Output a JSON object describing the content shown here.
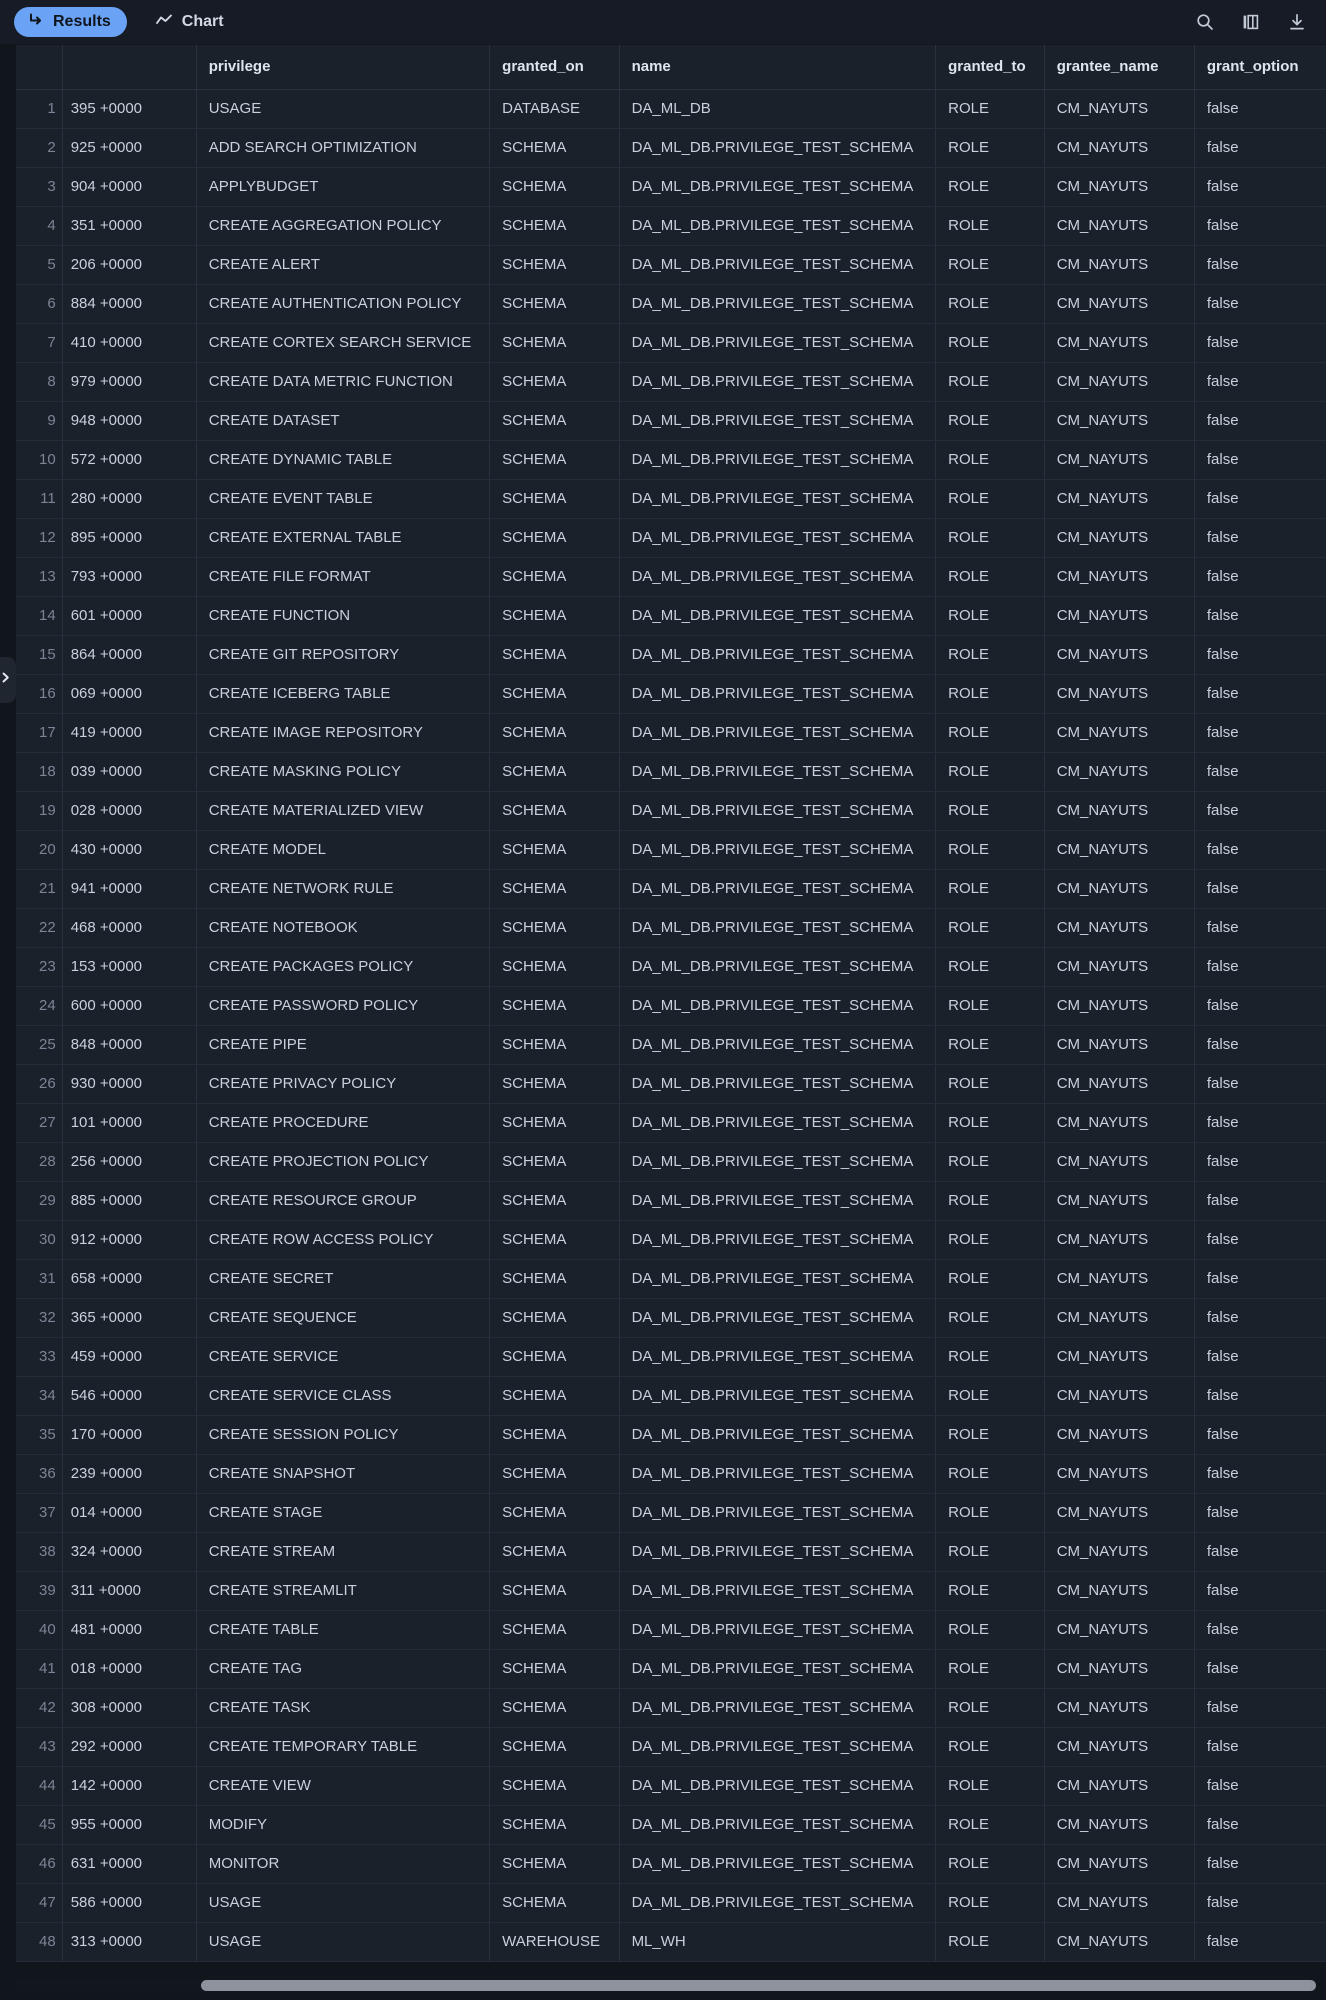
{
  "toolbar": {
    "results_tab": "Results",
    "chart_tab": "Chart",
    "results_icon": "return-arrow-icon",
    "chart_icon": "line-chart-icon",
    "search_icon": "search-icon",
    "columns_icon": "columns-icon",
    "download_icon": "download-icon",
    "accent_color": "#6aa3f5",
    "background_color": "#161b25"
  },
  "expand_handle": {
    "icon": "chevron-right-icon"
  },
  "table": {
    "columns": [
      {
        "key": "rownum",
        "label": ""
      },
      {
        "key": "timestamp",
        "label": ""
      },
      {
        "key": "privilege",
        "label": "privilege"
      },
      {
        "key": "granted_on",
        "label": "granted_on"
      },
      {
        "key": "name",
        "label": "name"
      },
      {
        "key": "granted_to",
        "label": "granted_to"
      },
      {
        "key": "grantee_name",
        "label": "grantee_name"
      },
      {
        "key": "grant_option",
        "label": "grant_option"
      }
    ],
    "rows": [
      {
        "n": "1",
        "ts": "395 +0000",
        "privilege": "USAGE",
        "granted_on": "DATABASE",
        "name": "DA_ML_DB",
        "granted_to": "ROLE",
        "grantee_name": "CM_NAYUTS",
        "grant_option": "false"
      },
      {
        "n": "2",
        "ts": "925 +0000",
        "privilege": "ADD SEARCH OPTIMIZATION",
        "granted_on": "SCHEMA",
        "name": "DA_ML_DB.PRIVILEGE_TEST_SCHEMA",
        "granted_to": "ROLE",
        "grantee_name": "CM_NAYUTS",
        "grant_option": "false"
      },
      {
        "n": "3",
        "ts": "904 +0000",
        "privilege": "APPLYBUDGET",
        "granted_on": "SCHEMA",
        "name": "DA_ML_DB.PRIVILEGE_TEST_SCHEMA",
        "granted_to": "ROLE",
        "grantee_name": "CM_NAYUTS",
        "grant_option": "false"
      },
      {
        "n": "4",
        "ts": "351 +0000",
        "privilege": "CREATE AGGREGATION POLICY",
        "granted_on": "SCHEMA",
        "name": "DA_ML_DB.PRIVILEGE_TEST_SCHEMA",
        "granted_to": "ROLE",
        "grantee_name": "CM_NAYUTS",
        "grant_option": "false"
      },
      {
        "n": "5",
        "ts": "206 +0000",
        "privilege": "CREATE ALERT",
        "granted_on": "SCHEMA",
        "name": "DA_ML_DB.PRIVILEGE_TEST_SCHEMA",
        "granted_to": "ROLE",
        "grantee_name": "CM_NAYUTS",
        "grant_option": "false"
      },
      {
        "n": "6",
        "ts": "884 +0000",
        "privilege": "CREATE AUTHENTICATION POLICY",
        "granted_on": "SCHEMA",
        "name": "DA_ML_DB.PRIVILEGE_TEST_SCHEMA",
        "granted_to": "ROLE",
        "grantee_name": "CM_NAYUTS",
        "grant_option": "false"
      },
      {
        "n": "7",
        "ts": "410 +0000",
        "privilege": "CREATE CORTEX SEARCH SERVICE",
        "granted_on": "SCHEMA",
        "name": "DA_ML_DB.PRIVILEGE_TEST_SCHEMA",
        "granted_to": "ROLE",
        "grantee_name": "CM_NAYUTS",
        "grant_option": "false"
      },
      {
        "n": "8",
        "ts": "979 +0000",
        "privilege": "CREATE DATA METRIC FUNCTION",
        "granted_on": "SCHEMA",
        "name": "DA_ML_DB.PRIVILEGE_TEST_SCHEMA",
        "granted_to": "ROLE",
        "grantee_name": "CM_NAYUTS",
        "grant_option": "false"
      },
      {
        "n": "9",
        "ts": "948 +0000",
        "privilege": "CREATE DATASET",
        "granted_on": "SCHEMA",
        "name": "DA_ML_DB.PRIVILEGE_TEST_SCHEMA",
        "granted_to": "ROLE",
        "grantee_name": "CM_NAYUTS",
        "grant_option": "false"
      },
      {
        "n": "10",
        "ts": "572 +0000",
        "privilege": "CREATE DYNAMIC TABLE",
        "granted_on": "SCHEMA",
        "name": "DA_ML_DB.PRIVILEGE_TEST_SCHEMA",
        "granted_to": "ROLE",
        "grantee_name": "CM_NAYUTS",
        "grant_option": "false"
      },
      {
        "n": "11",
        "ts": "280 +0000",
        "privilege": "CREATE EVENT TABLE",
        "granted_on": "SCHEMA",
        "name": "DA_ML_DB.PRIVILEGE_TEST_SCHEMA",
        "granted_to": "ROLE",
        "grantee_name": "CM_NAYUTS",
        "grant_option": "false"
      },
      {
        "n": "12",
        "ts": "895 +0000",
        "privilege": "CREATE EXTERNAL TABLE",
        "granted_on": "SCHEMA",
        "name": "DA_ML_DB.PRIVILEGE_TEST_SCHEMA",
        "granted_to": "ROLE",
        "grantee_name": "CM_NAYUTS",
        "grant_option": "false"
      },
      {
        "n": "13",
        "ts": "793 +0000",
        "privilege": "CREATE FILE FORMAT",
        "granted_on": "SCHEMA",
        "name": "DA_ML_DB.PRIVILEGE_TEST_SCHEMA",
        "granted_to": "ROLE",
        "grantee_name": "CM_NAYUTS",
        "grant_option": "false"
      },
      {
        "n": "14",
        "ts": "601 +0000",
        "privilege": "CREATE FUNCTION",
        "granted_on": "SCHEMA",
        "name": "DA_ML_DB.PRIVILEGE_TEST_SCHEMA",
        "granted_to": "ROLE",
        "grantee_name": "CM_NAYUTS",
        "grant_option": "false"
      },
      {
        "n": "15",
        "ts": "864 +0000",
        "privilege": "CREATE GIT REPOSITORY",
        "granted_on": "SCHEMA",
        "name": "DA_ML_DB.PRIVILEGE_TEST_SCHEMA",
        "granted_to": "ROLE",
        "grantee_name": "CM_NAYUTS",
        "grant_option": "false"
      },
      {
        "n": "16",
        "ts": "069 +0000",
        "privilege": "CREATE ICEBERG TABLE",
        "granted_on": "SCHEMA",
        "name": "DA_ML_DB.PRIVILEGE_TEST_SCHEMA",
        "granted_to": "ROLE",
        "grantee_name": "CM_NAYUTS",
        "grant_option": "false"
      },
      {
        "n": "17",
        "ts": "419 +0000",
        "privilege": "CREATE IMAGE REPOSITORY",
        "granted_on": "SCHEMA",
        "name": "DA_ML_DB.PRIVILEGE_TEST_SCHEMA",
        "granted_to": "ROLE",
        "grantee_name": "CM_NAYUTS",
        "grant_option": "false"
      },
      {
        "n": "18",
        "ts": "039 +0000",
        "privilege": "CREATE MASKING POLICY",
        "granted_on": "SCHEMA",
        "name": "DA_ML_DB.PRIVILEGE_TEST_SCHEMA",
        "granted_to": "ROLE",
        "grantee_name": "CM_NAYUTS",
        "grant_option": "false"
      },
      {
        "n": "19",
        "ts": "028 +0000",
        "privilege": "CREATE MATERIALIZED VIEW",
        "granted_on": "SCHEMA",
        "name": "DA_ML_DB.PRIVILEGE_TEST_SCHEMA",
        "granted_to": "ROLE",
        "grantee_name": "CM_NAYUTS",
        "grant_option": "false"
      },
      {
        "n": "20",
        "ts": "430 +0000",
        "privilege": "CREATE MODEL",
        "granted_on": "SCHEMA",
        "name": "DA_ML_DB.PRIVILEGE_TEST_SCHEMA",
        "granted_to": "ROLE",
        "grantee_name": "CM_NAYUTS",
        "grant_option": "false"
      },
      {
        "n": "21",
        "ts": "941 +0000",
        "privilege": "CREATE NETWORK RULE",
        "granted_on": "SCHEMA",
        "name": "DA_ML_DB.PRIVILEGE_TEST_SCHEMA",
        "granted_to": "ROLE",
        "grantee_name": "CM_NAYUTS",
        "grant_option": "false"
      },
      {
        "n": "22",
        "ts": "468 +0000",
        "privilege": "CREATE NOTEBOOK",
        "granted_on": "SCHEMA",
        "name": "DA_ML_DB.PRIVILEGE_TEST_SCHEMA",
        "granted_to": "ROLE",
        "grantee_name": "CM_NAYUTS",
        "grant_option": "false"
      },
      {
        "n": "23",
        "ts": "153 +0000",
        "privilege": "CREATE PACKAGES POLICY",
        "granted_on": "SCHEMA",
        "name": "DA_ML_DB.PRIVILEGE_TEST_SCHEMA",
        "granted_to": "ROLE",
        "grantee_name": "CM_NAYUTS",
        "grant_option": "false"
      },
      {
        "n": "24",
        "ts": "600 +0000",
        "privilege": "CREATE PASSWORD POLICY",
        "granted_on": "SCHEMA",
        "name": "DA_ML_DB.PRIVILEGE_TEST_SCHEMA",
        "granted_to": "ROLE",
        "grantee_name": "CM_NAYUTS",
        "grant_option": "false"
      },
      {
        "n": "25",
        "ts": "848 +0000",
        "privilege": "CREATE PIPE",
        "granted_on": "SCHEMA",
        "name": "DA_ML_DB.PRIVILEGE_TEST_SCHEMA",
        "granted_to": "ROLE",
        "grantee_name": "CM_NAYUTS",
        "grant_option": "false"
      },
      {
        "n": "26",
        "ts": "930 +0000",
        "privilege": "CREATE PRIVACY POLICY",
        "granted_on": "SCHEMA",
        "name": "DA_ML_DB.PRIVILEGE_TEST_SCHEMA",
        "granted_to": "ROLE",
        "grantee_name": "CM_NAYUTS",
        "grant_option": "false"
      },
      {
        "n": "27",
        "ts": "101 +0000",
        "privilege": "CREATE PROCEDURE",
        "granted_on": "SCHEMA",
        "name": "DA_ML_DB.PRIVILEGE_TEST_SCHEMA",
        "granted_to": "ROLE",
        "grantee_name": "CM_NAYUTS",
        "grant_option": "false"
      },
      {
        "n": "28",
        "ts": "256 +0000",
        "privilege": "CREATE PROJECTION POLICY",
        "granted_on": "SCHEMA",
        "name": "DA_ML_DB.PRIVILEGE_TEST_SCHEMA",
        "granted_to": "ROLE",
        "grantee_name": "CM_NAYUTS",
        "grant_option": "false"
      },
      {
        "n": "29",
        "ts": "885 +0000",
        "privilege": "CREATE RESOURCE GROUP",
        "granted_on": "SCHEMA",
        "name": "DA_ML_DB.PRIVILEGE_TEST_SCHEMA",
        "granted_to": "ROLE",
        "grantee_name": "CM_NAYUTS",
        "grant_option": "false"
      },
      {
        "n": "30",
        "ts": "912 +0000",
        "privilege": "CREATE ROW ACCESS POLICY",
        "granted_on": "SCHEMA",
        "name": "DA_ML_DB.PRIVILEGE_TEST_SCHEMA",
        "granted_to": "ROLE",
        "grantee_name": "CM_NAYUTS",
        "grant_option": "false"
      },
      {
        "n": "31",
        "ts": "658 +0000",
        "privilege": "CREATE SECRET",
        "granted_on": "SCHEMA",
        "name": "DA_ML_DB.PRIVILEGE_TEST_SCHEMA",
        "granted_to": "ROLE",
        "grantee_name": "CM_NAYUTS",
        "grant_option": "false"
      },
      {
        "n": "32",
        "ts": "365 +0000",
        "privilege": "CREATE SEQUENCE",
        "granted_on": "SCHEMA",
        "name": "DA_ML_DB.PRIVILEGE_TEST_SCHEMA",
        "granted_to": "ROLE",
        "grantee_name": "CM_NAYUTS",
        "grant_option": "false"
      },
      {
        "n": "33",
        "ts": "459 +0000",
        "privilege": "CREATE SERVICE",
        "granted_on": "SCHEMA",
        "name": "DA_ML_DB.PRIVILEGE_TEST_SCHEMA",
        "granted_to": "ROLE",
        "grantee_name": "CM_NAYUTS",
        "grant_option": "false"
      },
      {
        "n": "34",
        "ts": "546 +0000",
        "privilege": "CREATE SERVICE CLASS",
        "granted_on": "SCHEMA",
        "name": "DA_ML_DB.PRIVILEGE_TEST_SCHEMA",
        "granted_to": "ROLE",
        "grantee_name": "CM_NAYUTS",
        "grant_option": "false"
      },
      {
        "n": "35",
        "ts": "170 +0000",
        "privilege": "CREATE SESSION POLICY",
        "granted_on": "SCHEMA",
        "name": "DA_ML_DB.PRIVILEGE_TEST_SCHEMA",
        "granted_to": "ROLE",
        "grantee_name": "CM_NAYUTS",
        "grant_option": "false"
      },
      {
        "n": "36",
        "ts": "239 +0000",
        "privilege": "CREATE SNAPSHOT",
        "granted_on": "SCHEMA",
        "name": "DA_ML_DB.PRIVILEGE_TEST_SCHEMA",
        "granted_to": "ROLE",
        "grantee_name": "CM_NAYUTS",
        "grant_option": "false"
      },
      {
        "n": "37",
        "ts": "014 +0000",
        "privilege": "CREATE STAGE",
        "granted_on": "SCHEMA",
        "name": "DA_ML_DB.PRIVILEGE_TEST_SCHEMA",
        "granted_to": "ROLE",
        "grantee_name": "CM_NAYUTS",
        "grant_option": "false"
      },
      {
        "n": "38",
        "ts": "324 +0000",
        "privilege": "CREATE STREAM",
        "granted_on": "SCHEMA",
        "name": "DA_ML_DB.PRIVILEGE_TEST_SCHEMA",
        "granted_to": "ROLE",
        "grantee_name": "CM_NAYUTS",
        "grant_option": "false"
      },
      {
        "n": "39",
        "ts": "311 +0000",
        "privilege": "CREATE STREAMLIT",
        "granted_on": "SCHEMA",
        "name": "DA_ML_DB.PRIVILEGE_TEST_SCHEMA",
        "granted_to": "ROLE",
        "grantee_name": "CM_NAYUTS",
        "grant_option": "false"
      },
      {
        "n": "40",
        "ts": "481 +0000",
        "privilege": "CREATE TABLE",
        "granted_on": "SCHEMA",
        "name": "DA_ML_DB.PRIVILEGE_TEST_SCHEMA",
        "granted_to": "ROLE",
        "grantee_name": "CM_NAYUTS",
        "grant_option": "false"
      },
      {
        "n": "41",
        "ts": "018 +0000",
        "privilege": "CREATE TAG",
        "granted_on": "SCHEMA",
        "name": "DA_ML_DB.PRIVILEGE_TEST_SCHEMA",
        "granted_to": "ROLE",
        "grantee_name": "CM_NAYUTS",
        "grant_option": "false"
      },
      {
        "n": "42",
        "ts": "308 +0000",
        "privilege": "CREATE TASK",
        "granted_on": "SCHEMA",
        "name": "DA_ML_DB.PRIVILEGE_TEST_SCHEMA",
        "granted_to": "ROLE",
        "grantee_name": "CM_NAYUTS",
        "grant_option": "false"
      },
      {
        "n": "43",
        "ts": "292 +0000",
        "privilege": "CREATE TEMPORARY TABLE",
        "granted_on": "SCHEMA",
        "name": "DA_ML_DB.PRIVILEGE_TEST_SCHEMA",
        "granted_to": "ROLE",
        "grantee_name": "CM_NAYUTS",
        "grant_option": "false"
      },
      {
        "n": "44",
        "ts": "142 +0000",
        "privilege": "CREATE VIEW",
        "granted_on": "SCHEMA",
        "name": "DA_ML_DB.PRIVILEGE_TEST_SCHEMA",
        "granted_to": "ROLE",
        "grantee_name": "CM_NAYUTS",
        "grant_option": "false"
      },
      {
        "n": "45",
        "ts": "955 +0000",
        "privilege": "MODIFY",
        "granted_on": "SCHEMA",
        "name": "DA_ML_DB.PRIVILEGE_TEST_SCHEMA",
        "granted_to": "ROLE",
        "grantee_name": "CM_NAYUTS",
        "grant_option": "false"
      },
      {
        "n": "46",
        "ts": "631 +0000",
        "privilege": "MONITOR",
        "granted_on": "SCHEMA",
        "name": "DA_ML_DB.PRIVILEGE_TEST_SCHEMA",
        "granted_to": "ROLE",
        "grantee_name": "CM_NAYUTS",
        "grant_option": "false"
      },
      {
        "n": "47",
        "ts": "586 +0000",
        "privilege": "USAGE",
        "granted_on": "SCHEMA",
        "name": "DA_ML_DB.PRIVILEGE_TEST_SCHEMA",
        "granted_to": "ROLE",
        "grantee_name": "CM_NAYUTS",
        "grant_option": "false"
      },
      {
        "n": "48",
        "ts": "313 +0000",
        "privilege": "USAGE",
        "granted_on": "WAREHOUSE",
        "name": "ML_WH",
        "granted_to": "ROLE",
        "grantee_name": "CM_NAYUTS",
        "grant_option": "false"
      }
    ]
  }
}
